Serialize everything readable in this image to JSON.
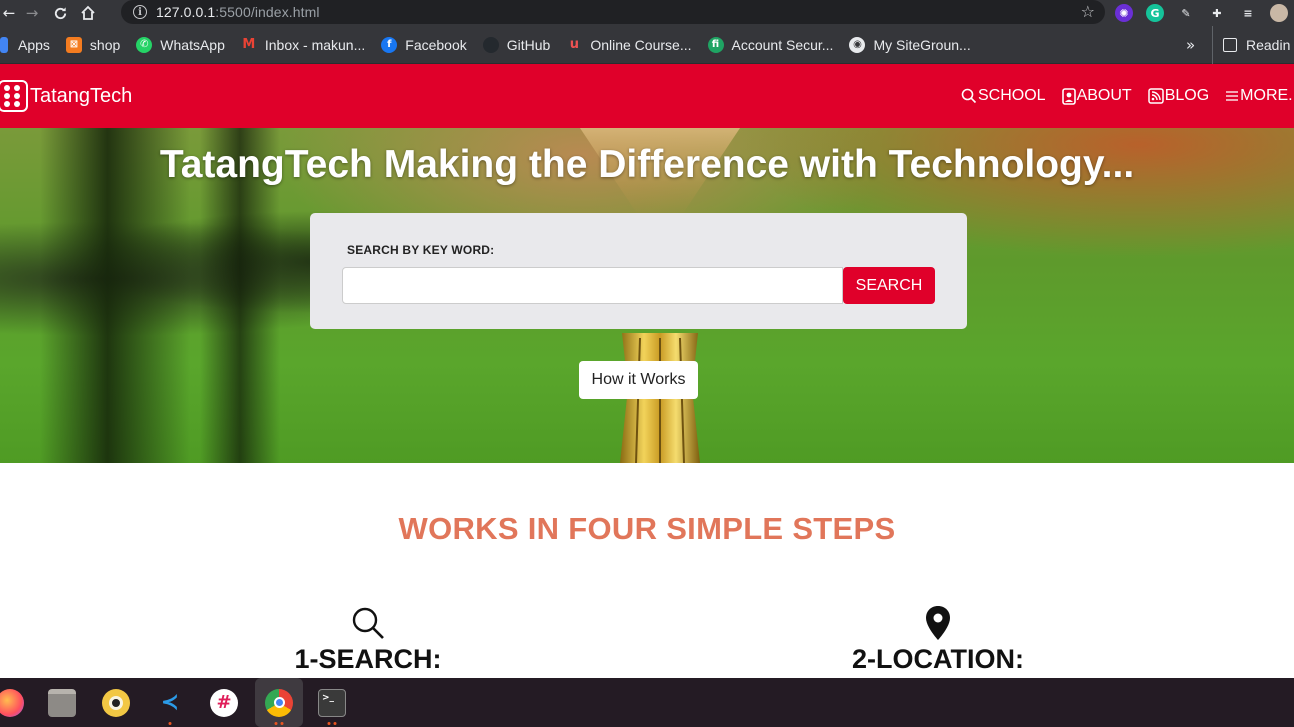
{
  "browser": {
    "url_host": "127.0.0.1",
    "url_path": ":5500/index.html",
    "bookmarks": [
      {
        "label": "Apps",
        "icon": "apps-grid-icon",
        "color": "#4285f4"
      },
      {
        "label": "shop",
        "icon": "shop-icon",
        "color": "#f47c20"
      },
      {
        "label": "WhatsApp",
        "icon": "whatsapp-icon",
        "color": "#25d366"
      },
      {
        "label": "Inbox - makun...",
        "icon": "gmail-icon",
        "color": "#d93025"
      },
      {
        "label": "Facebook",
        "icon": "facebook-icon",
        "color": "#1877f2"
      },
      {
        "label": "GitHub",
        "icon": "github-icon",
        "color": "#24292e"
      },
      {
        "label": "Online Course...",
        "icon": "udemy-icon",
        "color": "#a435f0"
      },
      {
        "label": "Account Secur...",
        "icon": "account-security-icon",
        "color": "#1fa463"
      },
      {
        "label": "My SiteGroun...",
        "icon": "siteground-icon",
        "color": "#7fb800"
      }
    ],
    "bookmarks_overflow": "»",
    "reading_list": "Readin"
  },
  "site": {
    "brand": "TatangTech",
    "nav": [
      {
        "label": "SCHOOL",
        "icon": "search-icon"
      },
      {
        "label": "ABOUT",
        "icon": "person-badge-icon"
      },
      {
        "label": "BLOG",
        "icon": "rss-icon"
      },
      {
        "label": "MORE.",
        "icon": "list-icon"
      }
    ],
    "accent_color": "#e0002a"
  },
  "hero": {
    "title": "TatangTech Making the Difference with Technology...",
    "search_label": "SEARCH BY KEY WORD:",
    "search_value": "",
    "search_button": "SEARCH",
    "how_button": "How it Works"
  },
  "steps": {
    "title": "WORKS IN FOUR SIMPLE STEPS",
    "title_color": "#e1765a",
    "items": [
      {
        "title": "1-SEARCH:",
        "icon": "search-icon"
      },
      {
        "title": "2-LOCATION:",
        "icon": "map-pin-icon"
      }
    ]
  },
  "taskbar": {
    "apps": [
      {
        "name": "firefox",
        "icon": "firefox-icon"
      },
      {
        "name": "files",
        "icon": "files-icon"
      },
      {
        "name": "rhythmbox",
        "icon": "rhythmbox-icon"
      },
      {
        "name": "vscode",
        "icon": "vscode-icon"
      },
      {
        "name": "slack",
        "icon": "slack-icon"
      },
      {
        "name": "chrome",
        "icon": "chrome-icon"
      },
      {
        "name": "terminal",
        "icon": "terminal-icon"
      }
    ]
  }
}
